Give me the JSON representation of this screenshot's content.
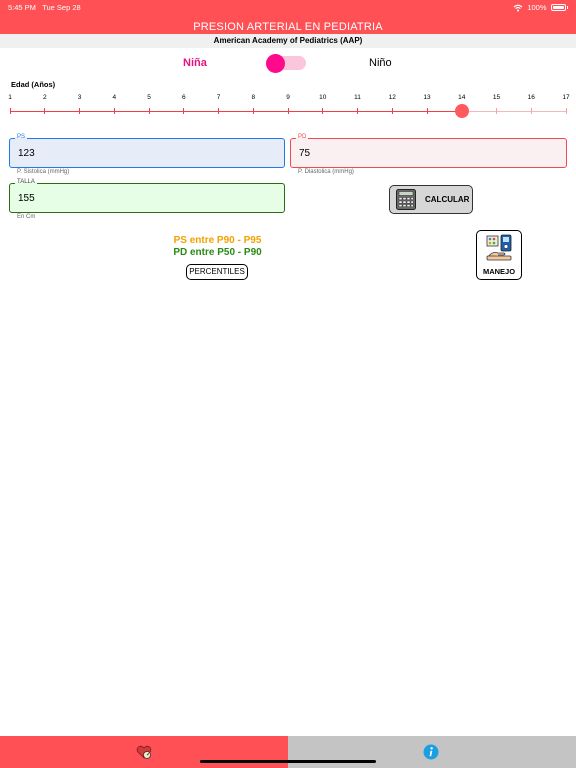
{
  "status_bar": {
    "time": "5:45 PM",
    "date": "Tue Sep 28",
    "battery": "100%"
  },
  "header": {
    "title": "PRESION ARTERIAL EN PEDIATRIA",
    "subtitle": "American Academy of Pediatrics (AAP)"
  },
  "gender": {
    "female_label": "Niña",
    "male_label": "Niño",
    "selected": "female"
  },
  "age": {
    "label": "Edad (Años)",
    "min": 1,
    "max": 17,
    "value": 14,
    "ticks": [
      "1",
      "2",
      "3",
      "4",
      "5",
      "6",
      "7",
      "8",
      "9",
      "10",
      "11",
      "12",
      "13",
      "14",
      "15",
      "16",
      "17"
    ]
  },
  "fields": {
    "ps": {
      "legend": "PS",
      "value": "123",
      "helper": "P. Sistolica (mmHg)"
    },
    "pd": {
      "legend": "PD",
      "value": "75",
      "helper": "P. Diastolica (mmHg)"
    },
    "talla": {
      "legend": "TALLA",
      "value": "155",
      "helper": "En Cm"
    }
  },
  "buttons": {
    "calcular": "CALCULAR",
    "percentiles": "PERCENTILES",
    "manejo": "MANEJO"
  },
  "results": {
    "ps": "PS entre P90 - P95",
    "pd": "PD entre P50 - P90"
  },
  "colors": {
    "primary_red": "#ff5155",
    "female_pink": "#e3157f",
    "ps_result": "#f2a100",
    "pd_result": "#2a8a16",
    "info_blue": "#1a9fe0"
  },
  "tabs": [
    {
      "icon": "heart-pressure-icon",
      "active": true
    },
    {
      "icon": "info-icon",
      "active": false
    }
  ]
}
